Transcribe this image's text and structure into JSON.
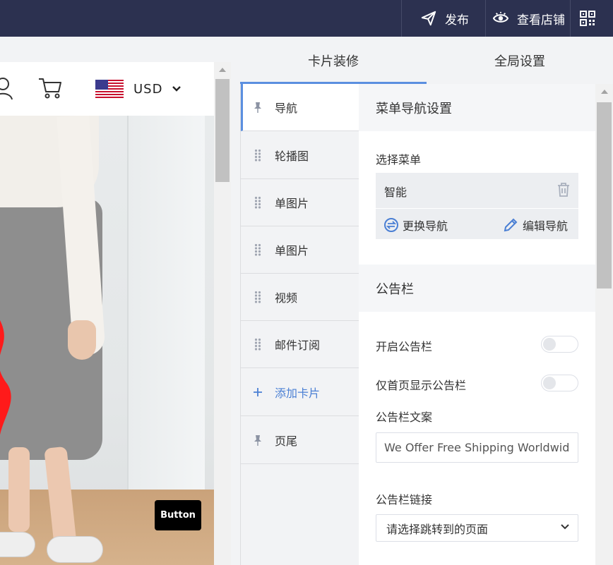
{
  "topbar": {
    "publish_label": "发布",
    "view_store_label": "查看店铺"
  },
  "preview": {
    "currency": "USD",
    "demo_button_label": "Button"
  },
  "panel": {
    "tabs": [
      {
        "label": "卡片装修",
        "active": true
      },
      {
        "label": "全局设置",
        "active": false
      }
    ],
    "cards": [
      {
        "label": "导航",
        "icon": "pin-icon",
        "active": true
      },
      {
        "label": "轮播图",
        "icon": "drag-handle-icon"
      },
      {
        "label": "单图片",
        "icon": "drag-handle-icon"
      },
      {
        "label": "单图片",
        "icon": "drag-handle-icon"
      },
      {
        "label": "视频",
        "icon": "drag-handle-icon"
      },
      {
        "label": "邮件订阅",
        "icon": "drag-handle-icon"
      },
      {
        "label": "添加卡片",
        "icon": "plus-icon"
      },
      {
        "label": "页尾",
        "icon": "pin-icon"
      }
    ],
    "menu_nav": {
      "section_title": "菜单导航设置",
      "select_menu_label": "选择菜单",
      "menu_name": "智能",
      "change_nav_label": "更换导航",
      "edit_nav_label": "编辑导航"
    },
    "announcement": {
      "section_title": "公告栏",
      "enable_label": "开启公告栏",
      "enable_on": false,
      "home_only_label": "仅首页显示公告栏",
      "home_only_on": false,
      "text_label": "公告栏文案",
      "text_value": "We Offer Free Shipping Worldwide.",
      "link_label": "公告栏链接",
      "link_placeholder": "请选择跳转到的页面"
    }
  },
  "colors": {
    "topbar_bg": "#2c3150",
    "accent": "#5b8fe0",
    "link_blue": "#4a7fd4"
  }
}
